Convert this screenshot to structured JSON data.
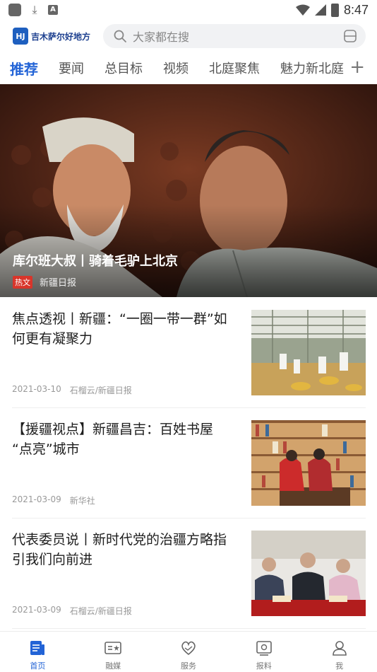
{
  "status_bar": {
    "time": "8:47"
  },
  "header": {
    "logo_text": "吉木萨尔好地方",
    "search_placeholder": "大家都在搜"
  },
  "tabs": [
    {
      "label": "推荐",
      "active": true
    },
    {
      "label": "要闻"
    },
    {
      "label": "总目标"
    },
    {
      "label": "视频"
    },
    {
      "label": "北庭聚焦"
    },
    {
      "label": "魅力新北庭"
    }
  ],
  "tab_add_label": "+",
  "hero": {
    "title": "库尔班大叔丨骑着毛驴上北京",
    "badge": "热文",
    "source": "新疆日报"
  },
  "news": [
    {
      "title": "焦点透视丨新疆：“一圈一带一群”如何更有凝聚力",
      "date": "2021-03-10",
      "source": "石榴云/新疆日报"
    },
    {
      "title": "【援疆视点】新疆昌吉：百姓书屋 “点亮”城市",
      "date": "2021-03-09",
      "source": "新华社"
    },
    {
      "title": "代表委员说丨新时代党的治疆方略指引我们向前进",
      "date": "2021-03-09",
      "source": "石榴云/新疆日报"
    }
  ],
  "bottom_nav": [
    {
      "label": "首页",
      "icon": "home-news-icon",
      "active": true
    },
    {
      "label": "融媒",
      "icon": "media-icon"
    },
    {
      "label": "服务",
      "icon": "heart-hand-icon"
    },
    {
      "label": "报料",
      "icon": "report-icon"
    },
    {
      "label": "我",
      "icon": "user-icon"
    }
  ],
  "colors": {
    "accent": "#2263d6",
    "hot_badge": "#d8352a"
  }
}
